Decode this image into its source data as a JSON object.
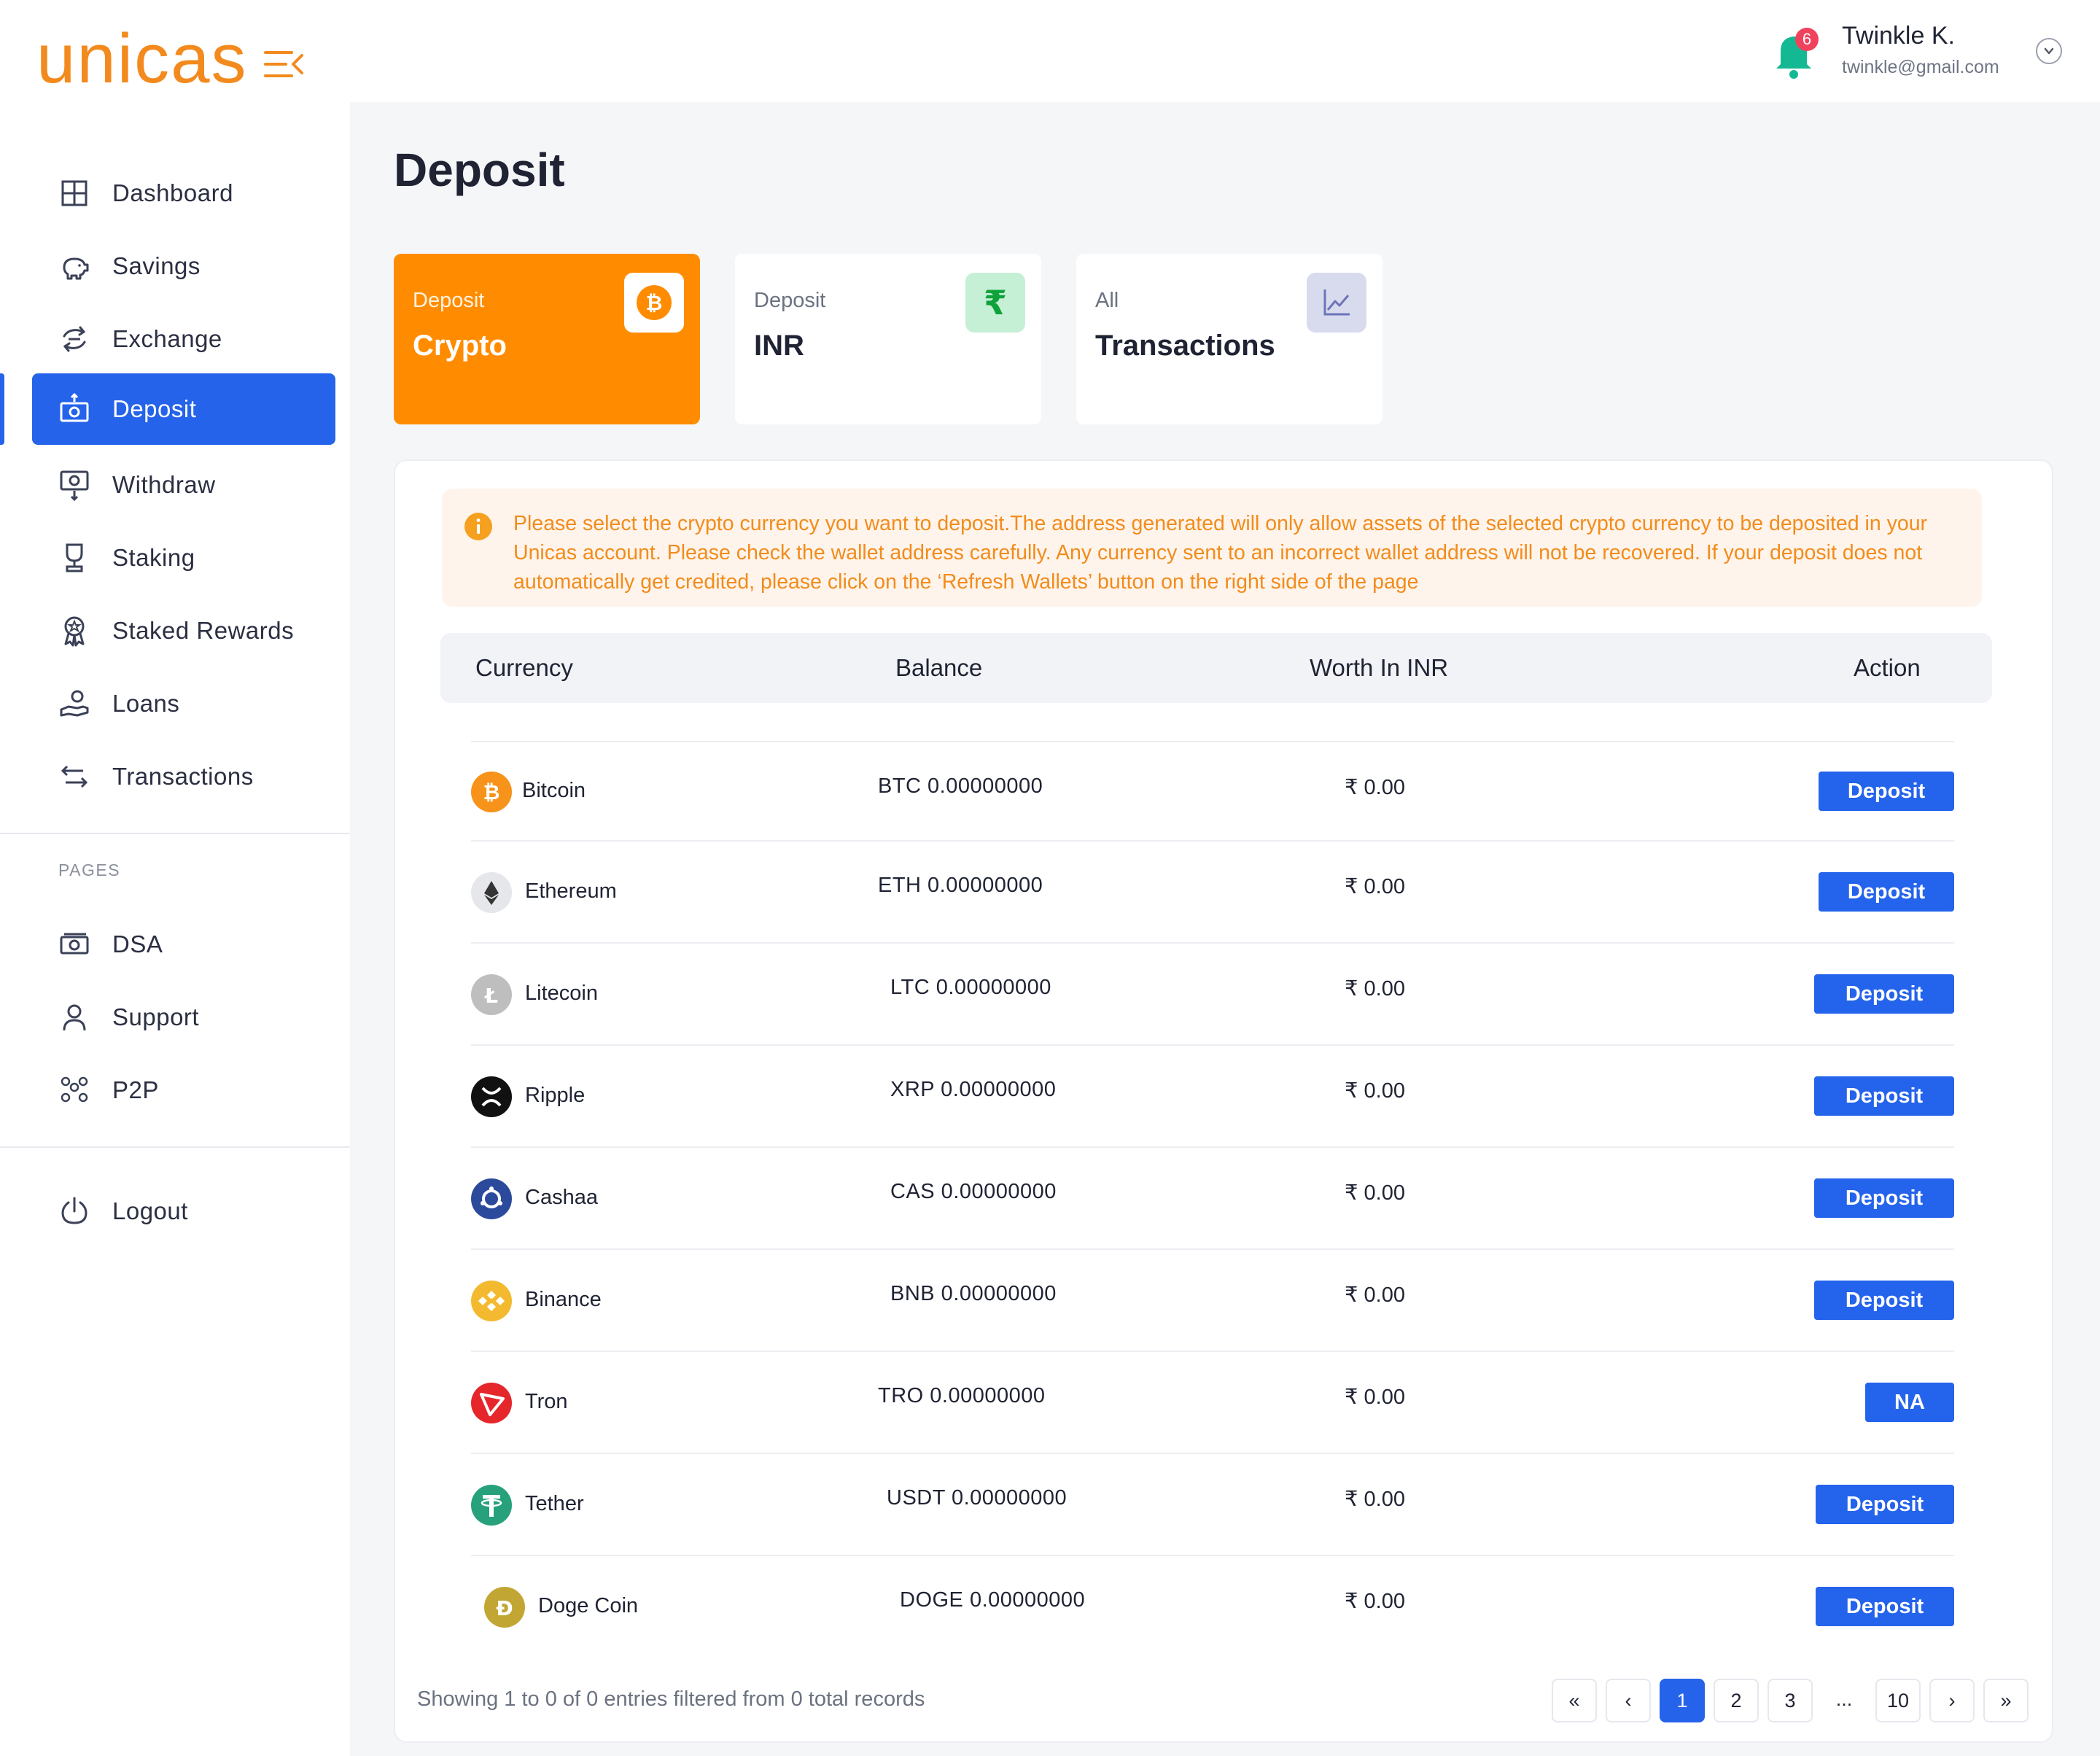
{
  "brand": {
    "logo_text": "unicas",
    "accent": "#f38a1e",
    "primary": "#2563eb"
  },
  "header": {
    "notifications_count": "6",
    "user_name": "Twinkle K.",
    "user_email": "twinkle@gmail.com"
  },
  "sidebar": {
    "items": [
      {
        "label": "Dashboard",
        "icon": "grid-icon"
      },
      {
        "label": "Savings",
        "icon": "piggy-bank-icon"
      },
      {
        "label": "Exchange",
        "icon": "exchange-icon"
      },
      {
        "label": "Deposit",
        "icon": "deposit-icon",
        "active": true
      },
      {
        "label": "Withdraw",
        "icon": "withdraw-icon"
      },
      {
        "label": "Staking",
        "icon": "trophy-icon"
      },
      {
        "label": "Staked Rewards",
        "icon": "badge-icon"
      },
      {
        "label": "Loans",
        "icon": "hand-coin-icon"
      },
      {
        "label": "Transactions",
        "icon": "arrows-icon"
      }
    ],
    "pages_label": "PAGES",
    "pages": [
      {
        "label": "DSA",
        "icon": "cash-icon"
      },
      {
        "label": "Support",
        "icon": "user-icon"
      },
      {
        "label": "P2P",
        "icon": "people-icon"
      }
    ],
    "logout_label": "Logout"
  },
  "main": {
    "title": "Deposit",
    "tabs": [
      {
        "sub": "Deposit",
        "label": "Crypto",
        "icon": "bitcoin-icon",
        "active": true
      },
      {
        "sub": "Deposit",
        "label": "INR",
        "icon": "rupee-icon"
      },
      {
        "sub": "All",
        "label": "Transactions",
        "icon": "chart-icon"
      }
    ],
    "notice": "Please select the crypto currency you want to deposit.The address generated will only allow assets of the selected crypto currency to be deposited in your Unicas account. Please check the wallet address carefully. Any currency sent to an incorrect wallet address will not be recovered. If your deposit does not automatically get credited, please click on the ‘Refresh Wallets’ button on the right side of the page",
    "table": {
      "columns": [
        "Currency",
        "Balance",
        "Worth In INR",
        "Action"
      ],
      "rows": [
        {
          "name": "Bitcoin",
          "balance": "BTC 0.00000000",
          "inr": "₹ 0.00",
          "action": "Deposit",
          "icon": "bitcoin-icon",
          "color": "#f7931a"
        },
        {
          "name": "Ethereum",
          "balance": "ETH 0.00000000",
          "inr": "₹ 0.00",
          "action": "Deposit",
          "icon": "ethereum-icon",
          "color": "#e6e7ea"
        },
        {
          "name": "Litecoin",
          "balance": "LTC 0.00000000",
          "inr": "₹ 0.00",
          "action": "Deposit",
          "icon": "litecoin-icon",
          "color": "#bebebe"
        },
        {
          "name": "Ripple",
          "balance": "XRP 0.00000000",
          "inr": "₹ 0.00",
          "action": "Deposit",
          "icon": "ripple-icon",
          "color": "#111111"
        },
        {
          "name": "Cashaa",
          "balance": "CAS 0.00000000",
          "inr": "₹ 0.00",
          "action": "Deposit",
          "icon": "cashaa-icon",
          "color": "#2b4a9c"
        },
        {
          "name": "Binance",
          "balance": "BNB 0.00000000",
          "inr": "₹ 0.00",
          "action": "Deposit",
          "icon": "binance-icon",
          "color": "#f3ba2f"
        },
        {
          "name": "Tron",
          "balance": "TRO 0.00000000",
          "inr": "₹ 0.00",
          "action": "NA",
          "icon": "tron-icon",
          "color": "#e5262b"
        },
        {
          "name": "Tether",
          "balance": "USDT 0.00000000",
          "inr": "₹ 0.00",
          "action": "Deposit",
          "icon": "tether-icon",
          "color": "#26a17b"
        },
        {
          "name": "Doge Coin",
          "balance": "DOGE 0.00000000",
          "inr": "₹ 0.00",
          "action": "Deposit",
          "icon": "doge-icon",
          "color": "#c2a633"
        }
      ]
    },
    "footer": {
      "summary": "Showing 1 to 0 of 0 entries filtered from 0 total records",
      "pagination": {
        "first": "«",
        "prev": "‹",
        "pages": [
          "1",
          "2",
          "3",
          "...",
          "10"
        ],
        "current": "1",
        "next": "›",
        "last": "»"
      }
    }
  }
}
